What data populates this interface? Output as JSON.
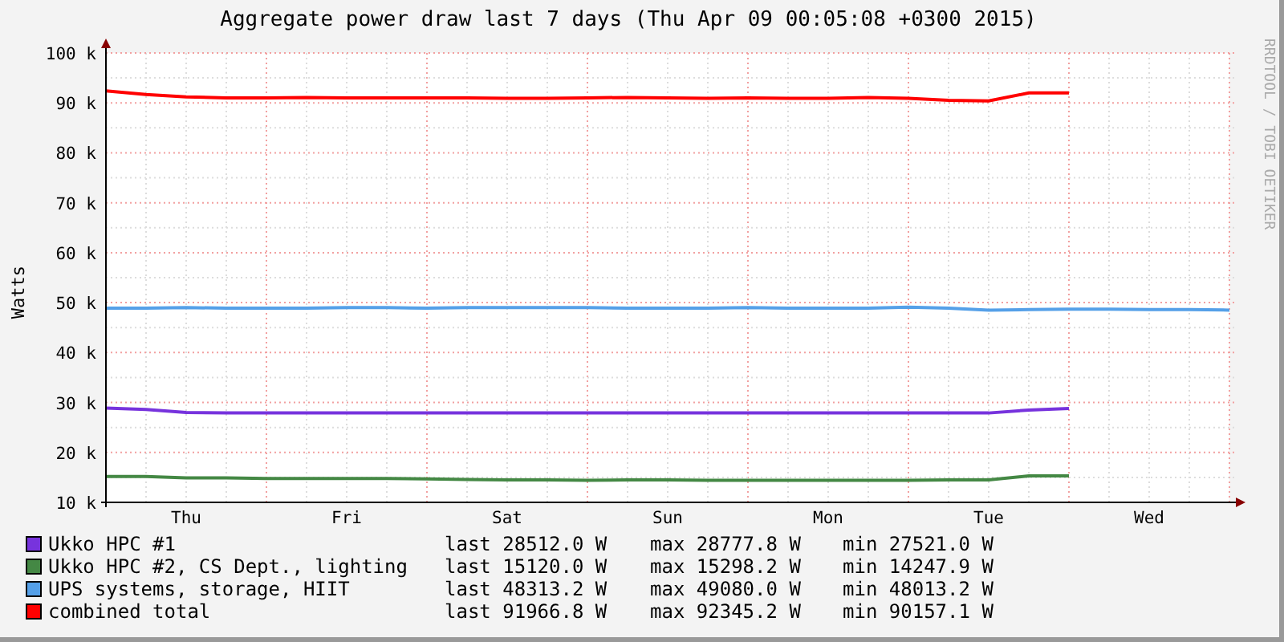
{
  "title": "Aggregate power draw last 7 days (Thu Apr 09 00:05:08 +0300 2015)",
  "side_label": "RRDTOOL / TOBI OETIKER",
  "chart_data": {
    "type": "line",
    "ylabel": "Watts",
    "categories": [
      null,
      null,
      "Thu",
      null,
      null,
      null,
      "Fri",
      null,
      null,
      null,
      "Sat",
      null,
      null,
      null,
      "Sun",
      null,
      null,
      null,
      "Mon",
      null,
      null,
      null,
      "Tue",
      null,
      null,
      null,
      "Wed",
      null,
      null
    ],
    "ylim": [
      10000,
      100000
    ],
    "grid": true,
    "yticks": [
      {
        "value": 10000,
        "label": "10 k"
      },
      {
        "value": 20000,
        "label": "20 k"
      },
      {
        "value": 30000,
        "label": "30 k"
      },
      {
        "value": 40000,
        "label": "40 k"
      },
      {
        "value": 50000,
        "label": "50 k"
      },
      {
        "value": 60000,
        "label": "60 k"
      },
      {
        "value": 70000,
        "label": "70 k"
      },
      {
        "value": 80000,
        "label": "80 k"
      },
      {
        "value": 90000,
        "label": "90 k"
      },
      {
        "value": 100000,
        "label": "100 k"
      }
    ],
    "series": [
      {
        "name": "Ukko HPC #1",
        "color": "#7733dd",
        "values": [
          28900,
          28600,
          28000,
          27900,
          27900,
          27900,
          27900,
          27900,
          27900,
          27900,
          27900,
          27900,
          27900,
          27900,
          27900,
          27900,
          27900,
          27900,
          27900,
          27900,
          27900,
          27900,
          27900,
          28500,
          28800,
          null,
          null,
          null,
          null
        ]
      },
      {
        "name": "Ukko HPC #2, CS Dept., lighting",
        "color": "#448844",
        "values": [
          15200,
          15200,
          14900,
          14900,
          14800,
          14800,
          14800,
          14800,
          14700,
          14600,
          14500,
          14500,
          14400,
          14500,
          14500,
          14400,
          14400,
          14400,
          14400,
          14400,
          14400,
          14500,
          14500,
          15300,
          15300,
          null,
          null,
          null,
          null
        ]
      },
      {
        "name": "UPS systems, storage, HIIT",
        "color": "#55a0e8",
        "values": [
          48900,
          48900,
          49000,
          48900,
          48900,
          48900,
          49000,
          49000,
          48900,
          49000,
          49000,
          49000,
          49000,
          48900,
          48900,
          48900,
          49000,
          48900,
          48900,
          48900,
          49100,
          48900,
          48500,
          48600,
          48700,
          48700,
          48600,
          48600,
          48500
        ]
      },
      {
        "name": "combined total",
        "color": "#ff0000",
        "values": [
          92400,
          91700,
          91200,
          91000,
          91000,
          91100,
          91000,
          91000,
          91000,
          91000,
          90900,
          90900,
          91000,
          91100,
          91000,
          90900,
          91000,
          90900,
          90900,
          91100,
          90900,
          90500,
          90400,
          92000,
          92000,
          null,
          null,
          null,
          null
        ]
      }
    ]
  },
  "legend": [
    {
      "last": "last 28512.0 W",
      "max": "max 28777.8 W",
      "min": "min 27521.0 W"
    },
    {
      "last": "last 15120.0 W",
      "max": "max 15298.2 W",
      "min": "min 14247.9 W"
    },
    {
      "last": "last 48313.2 W",
      "max": "max 49080.0 W",
      "min": "min 48013.2 W"
    },
    {
      "last": "last 91966.8 W",
      "max": "max 92345.2 W",
      "min": "min 90157.1 W"
    }
  ]
}
